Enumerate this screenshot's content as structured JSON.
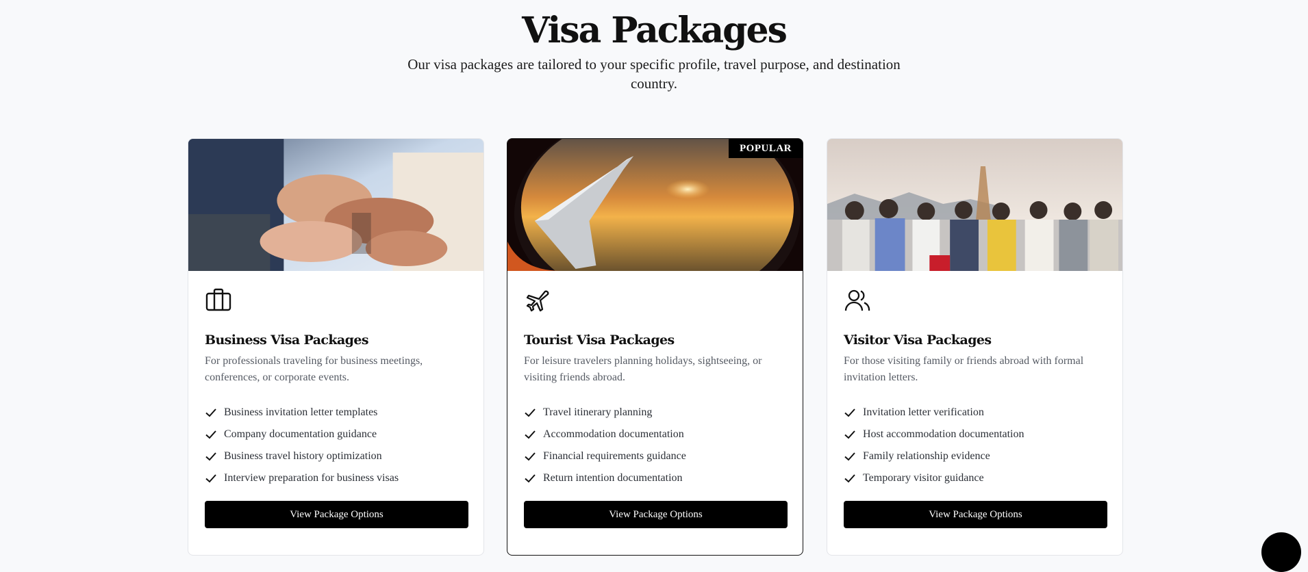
{
  "hero": {
    "title": "Visa Packages",
    "subtitle": "Our visa packages are tailored to your specific profile, travel purpose, and destination country."
  },
  "cards": [
    {
      "title": "Business Visa Packages",
      "description": "For professionals traveling for business meetings, conferences, or corporate events.",
      "icon": "briefcase-icon",
      "image": "business-team-hands-image",
      "features": [
        "Business invitation letter templates",
        "Company documentation guidance",
        "Business travel history optimization",
        "Interview preparation for business visas"
      ],
      "cta": "View Package Options"
    },
    {
      "title": "Tourist Visa Packages",
      "badge": "POPULAR",
      "description": "For leisure travelers planning holidays, sightseeing, or visiting friends abroad.",
      "icon": "plane-icon",
      "image": "airplane-window-sunset-image",
      "features": [
        "Travel itinerary planning",
        "Accommodation documentation",
        "Financial requirements guidance",
        "Return intention documentation"
      ],
      "cta": "View Package Options"
    },
    {
      "title": "Visitor Visa Packages",
      "description": "For those visiting family or friends abroad with formal invitation letters.",
      "icon": "users-icon",
      "image": "friends-group-seaside-image",
      "features": [
        "Invitation letter verification",
        "Host accommodation documentation",
        "Family relationship evidence",
        "Temporary visitor guidance"
      ],
      "cta": "View Package Options"
    }
  ],
  "colors": {
    "accent": "#000000",
    "background": "#f8f9fb",
    "muted_text": "#555a63"
  }
}
